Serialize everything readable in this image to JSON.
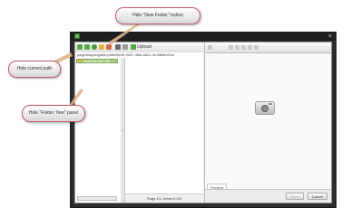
{
  "callouts": {
    "new_folder": "Hide \"New Folder\" button",
    "current_path": "Hide current path",
    "folder_tree": "Hide \"Folder Tree\" panel"
  },
  "toolbar": {
    "upload_label": "Upload"
  },
  "path": {
    "value": "pageimages/gallery/a5d9fcd5-9c57-4f66-8831-2b3f8f5e4f1b/"
  },
  "tree": {
    "selected_item": "a5d9fcd5-9c57-4f6"
  },
  "file_list": {
    "footer": "Page 1/1, Items 0-0/0"
  },
  "preview": {
    "tab_label": "Preview"
  },
  "dialog": {
    "select_label": "Select",
    "cancel_label": "Cancel"
  },
  "colors": {
    "callout_border": "#c55a6a",
    "window_frame": "#2e2e2e",
    "tree_selection": "#a9cd87",
    "arrow": "#e0b08a"
  },
  "icons": [
    "back-icon",
    "forward-icon",
    "refresh-icon",
    "new-folder-icon",
    "delete-icon",
    "view-toggle-icon",
    "upload-icon",
    "camera-icon",
    "folder-icon",
    "close-icon"
  ]
}
